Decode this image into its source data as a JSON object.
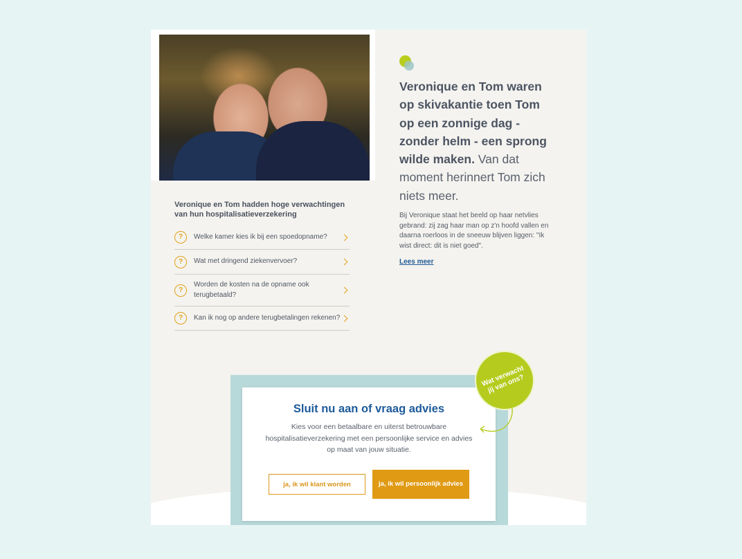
{
  "story": {
    "quote_bold": "Veronique en Tom waren op skivakantie toen Tom op een zonnige dag - zonder helm - een sprong wilde maken.",
    "quote_rest": " Van dat moment herinnert Tom zich niets meer.",
    "description": "Bij Veronique staat het beeld op haar netvlies gebrand: zij zag haar man op z'n hoofd vallen en daarna roerloos in de sneeuw blijven liggen: \"Ik wist direct: dit is niet goed\".",
    "read_more": "Lees meer"
  },
  "faq": {
    "title": "Veronique en Tom hadden hoge verwachtingen van hun hospitalisatieverzekering",
    "icon": "question-circle-icon",
    "items": [
      {
        "label": "Welke kamer kies ik bij een spoedopname?"
      },
      {
        "label": "Wat met dringend ziekenvervoer?"
      },
      {
        "label": "Worden de kosten na de opname ook terugbetaald?"
      },
      {
        "label": "Kan ik nog op andere terugbetalingen rekenen?"
      }
    ]
  },
  "cta": {
    "title": "Sluit nu aan of vraag advies",
    "text": "Kies voor een betaalbare en uiterst betrouwbare hospitalisatieverzekering met een persoonlijke service en advies op maat van jouw situatie.",
    "button_customer": "ja, ik wil klant worden",
    "button_advice": "ja, ik wil persoonlijk advies"
  },
  "badge": {
    "text": "Wat verwacht jij van ons?"
  },
  "colors": {
    "background": "#e6f5f4",
    "card": "#f4f3ef",
    "accent_orange": "#e09a14",
    "accent_lime": "#b5cc1f",
    "title_blue": "#1d5a9b"
  }
}
